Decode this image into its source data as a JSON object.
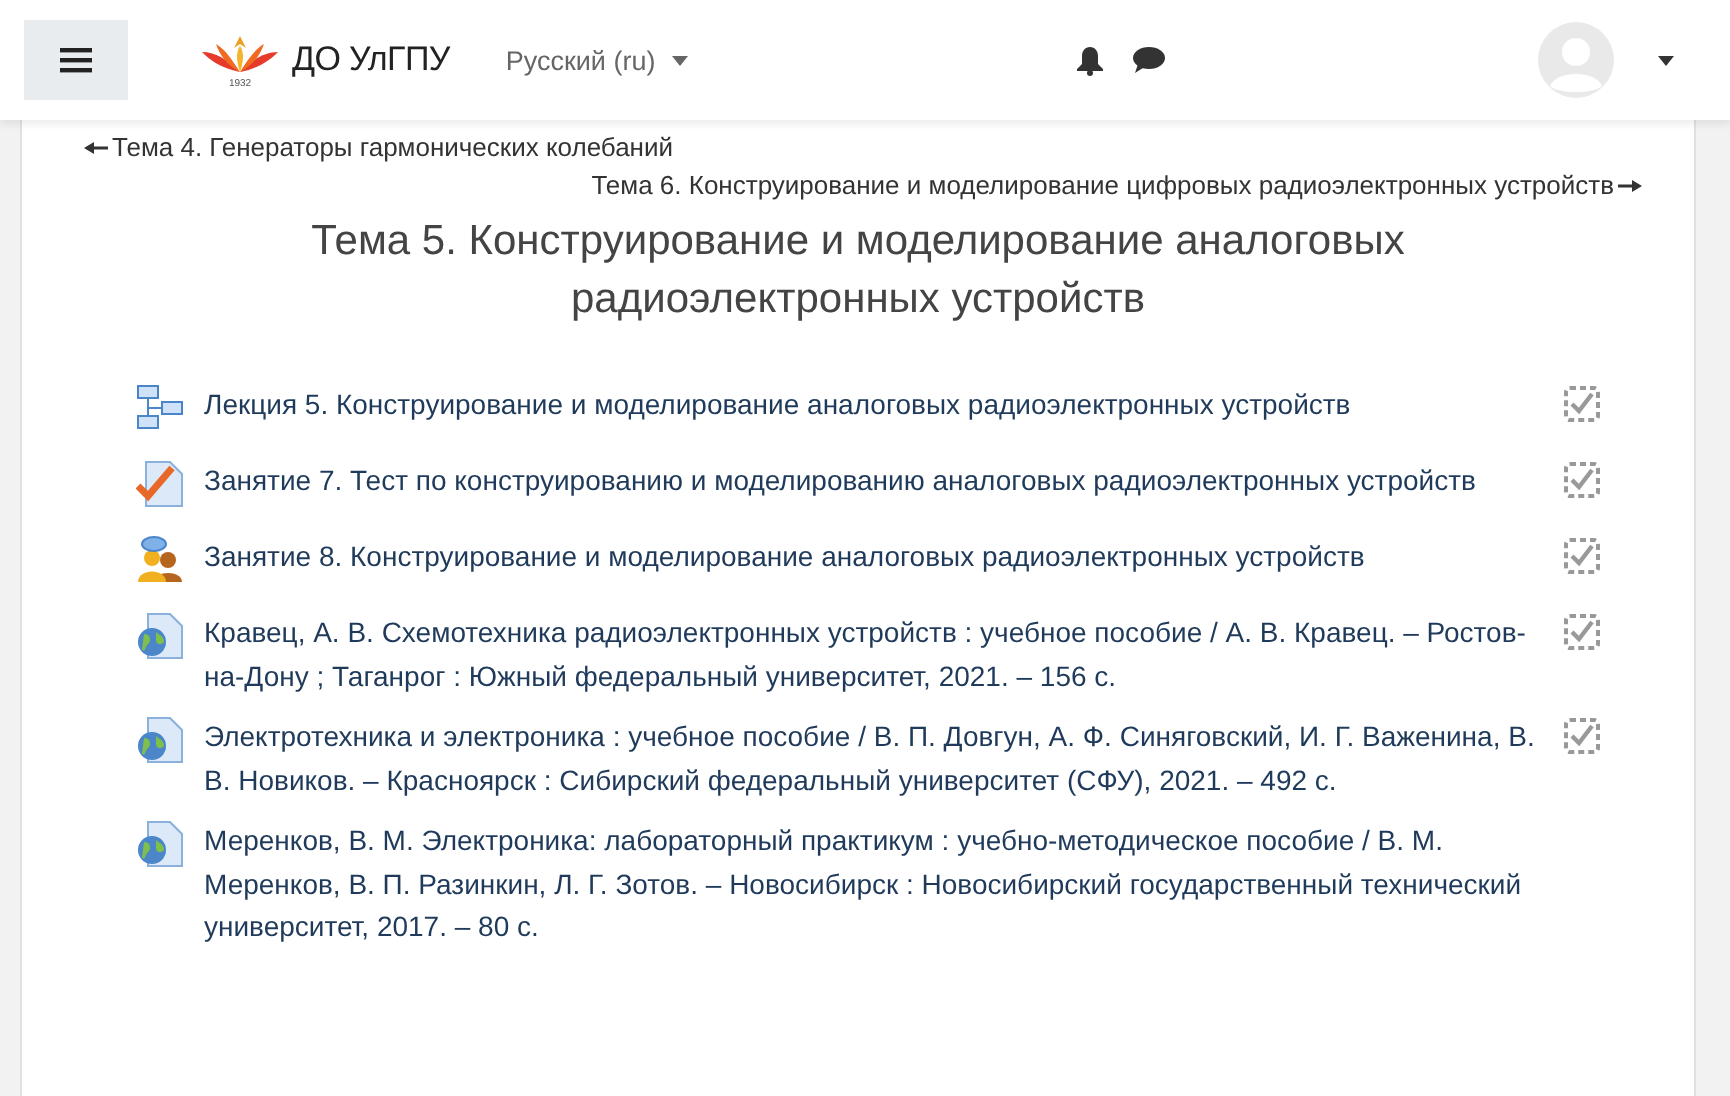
{
  "header": {
    "site_name": "ДО УлГПУ",
    "logo_year": "1932",
    "language": "Русский (ru)"
  },
  "navigation": {
    "previous": "Тема 4. Генераторы гармонических колебаний",
    "next": "Тема 6. Конструирование и моделирование цифровых радиоэлектронных устройств"
  },
  "section_title": "Тема 5. Конструирование и моделирование аналоговых радиоэлектронных устройств",
  "activities": [
    {
      "kind": "lesson",
      "name": "Лекция 5. Конструирование и моделирование аналоговых радиоэлектронных устройств",
      "completion": true
    },
    {
      "kind": "quiz",
      "name": "Занятие 7. Тест по конструированию и моделированию аналоговых радиоэлектронных устройств",
      "completion": true
    },
    {
      "kind": "workshop",
      "name": "Занятие 8. Конструирование и моделирование аналоговых радиоэлектронных устройств",
      "completion": true
    },
    {
      "kind": "url",
      "name": "Кравец, А. В. Схемотехника радиоэлектронных устройств : учебное пособие / А. В. Кравец. – Ростов-на-Дону ; Таганрог : Южный федеральный университет, 2021. – 156 с.",
      "completion": true
    },
    {
      "kind": "url",
      "name": "Электротехника и электроника : учебное пособие / В. П. Довгун, А. Ф. Синяговский, И. Г. Важенина, В. В. Новиков. – Красноярск : Сибирский федеральный университет (СФУ), 2021. – 492 с.",
      "completion": true
    },
    {
      "kind": "url",
      "name": "Меренков, В. М. Электроника: лабораторный практикум : учебно-методическое пособие / В. М. Меренков, В. П. Разинкин, Л. Г. Зотов. – Новосибирск : Новосибирский государственный технический университет, 2017. – 80 с.",
      "completion": false
    }
  ]
}
